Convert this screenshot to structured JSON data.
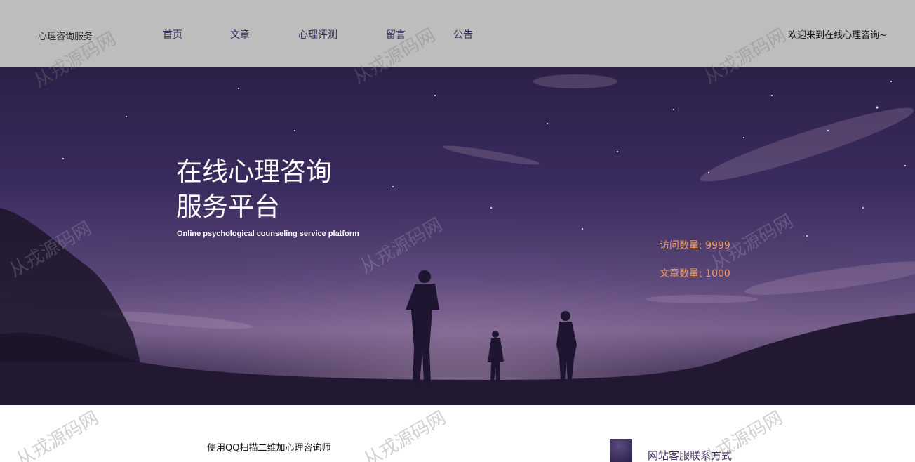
{
  "header": {
    "brand": "心理咨询服务",
    "nav": [
      {
        "label": "首页"
      },
      {
        "label": "文章"
      },
      {
        "label": "心理评测"
      },
      {
        "label": "留言"
      },
      {
        "label": "公告"
      }
    ],
    "welcome": "欢迎来到在线心理咨询~"
  },
  "hero": {
    "title_line1": "在线心理咨询",
    "title_line2": "服务平台",
    "subtitle": "Online psychological counseling service platform",
    "stats": {
      "visits": "访问数量: 9999",
      "articles": "文章数量: 1000"
    }
  },
  "bottom": {
    "qq_text": "使用QQ扫描二维加心理咨询师",
    "service_text": "网站客服联系方式"
  },
  "watermark": "从戎源码网",
  "colors": {
    "header_bg": "#bdbdbd",
    "nav_text": "#3c2a5c",
    "stat_text": "#f0a060",
    "hero_bg": "#3a2b5e"
  }
}
